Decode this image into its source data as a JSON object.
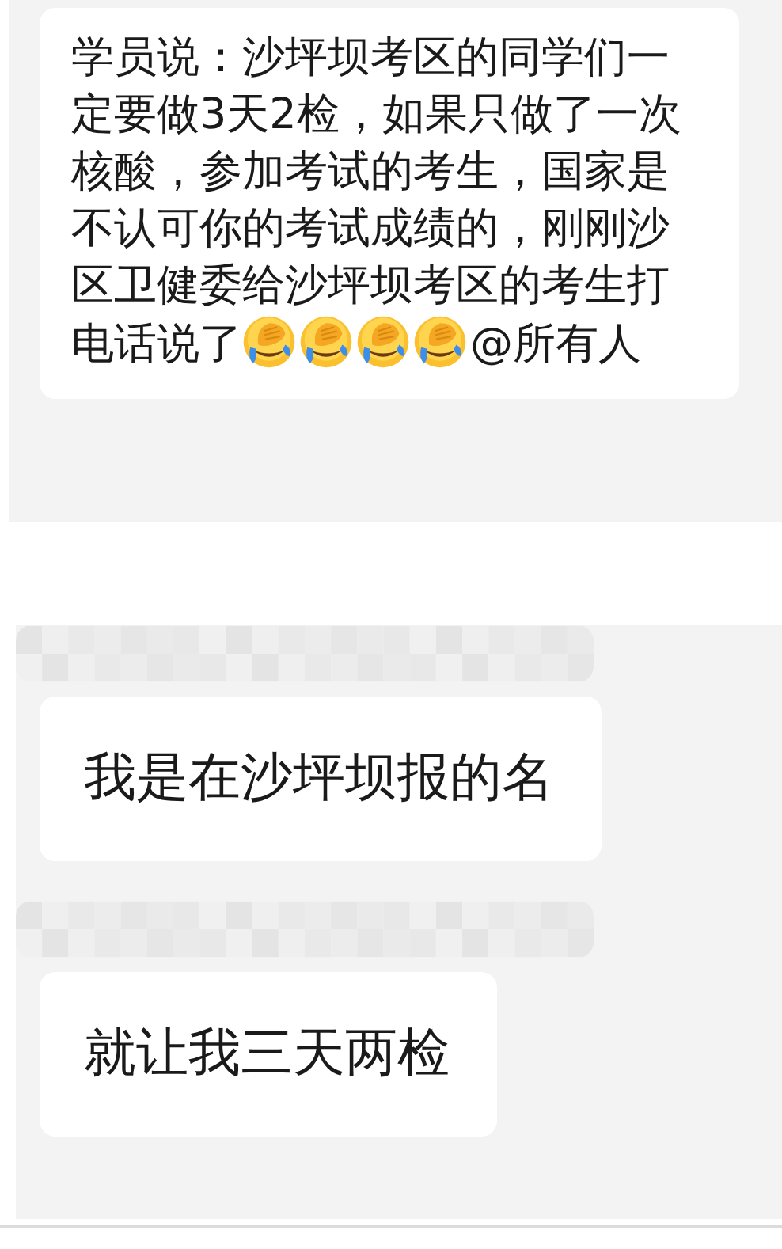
{
  "top_message": {
    "segments": [
      {
        "kind": "text",
        "text": "学员说：沙坪坝考区的同学们一定要做3天2检，如果只做了一次核酸，参加考试的考生，国家是不认可你的考试成绩的，刚刚沙区卫健委给沙坪坝考区的考生打电话说了"
      },
      {
        "kind": "emoji"
      },
      {
        "kind": "emoji"
      },
      {
        "kind": "emoji"
      },
      {
        "kind": "emoji"
      },
      {
        "kind": "text",
        "text": "@所有人"
      }
    ]
  },
  "messages": [
    {
      "sender_blurred": true,
      "text": "我是在沙坪坝报的名"
    },
    {
      "sender_blurred": true,
      "text": "就让我三天两检"
    }
  ]
}
